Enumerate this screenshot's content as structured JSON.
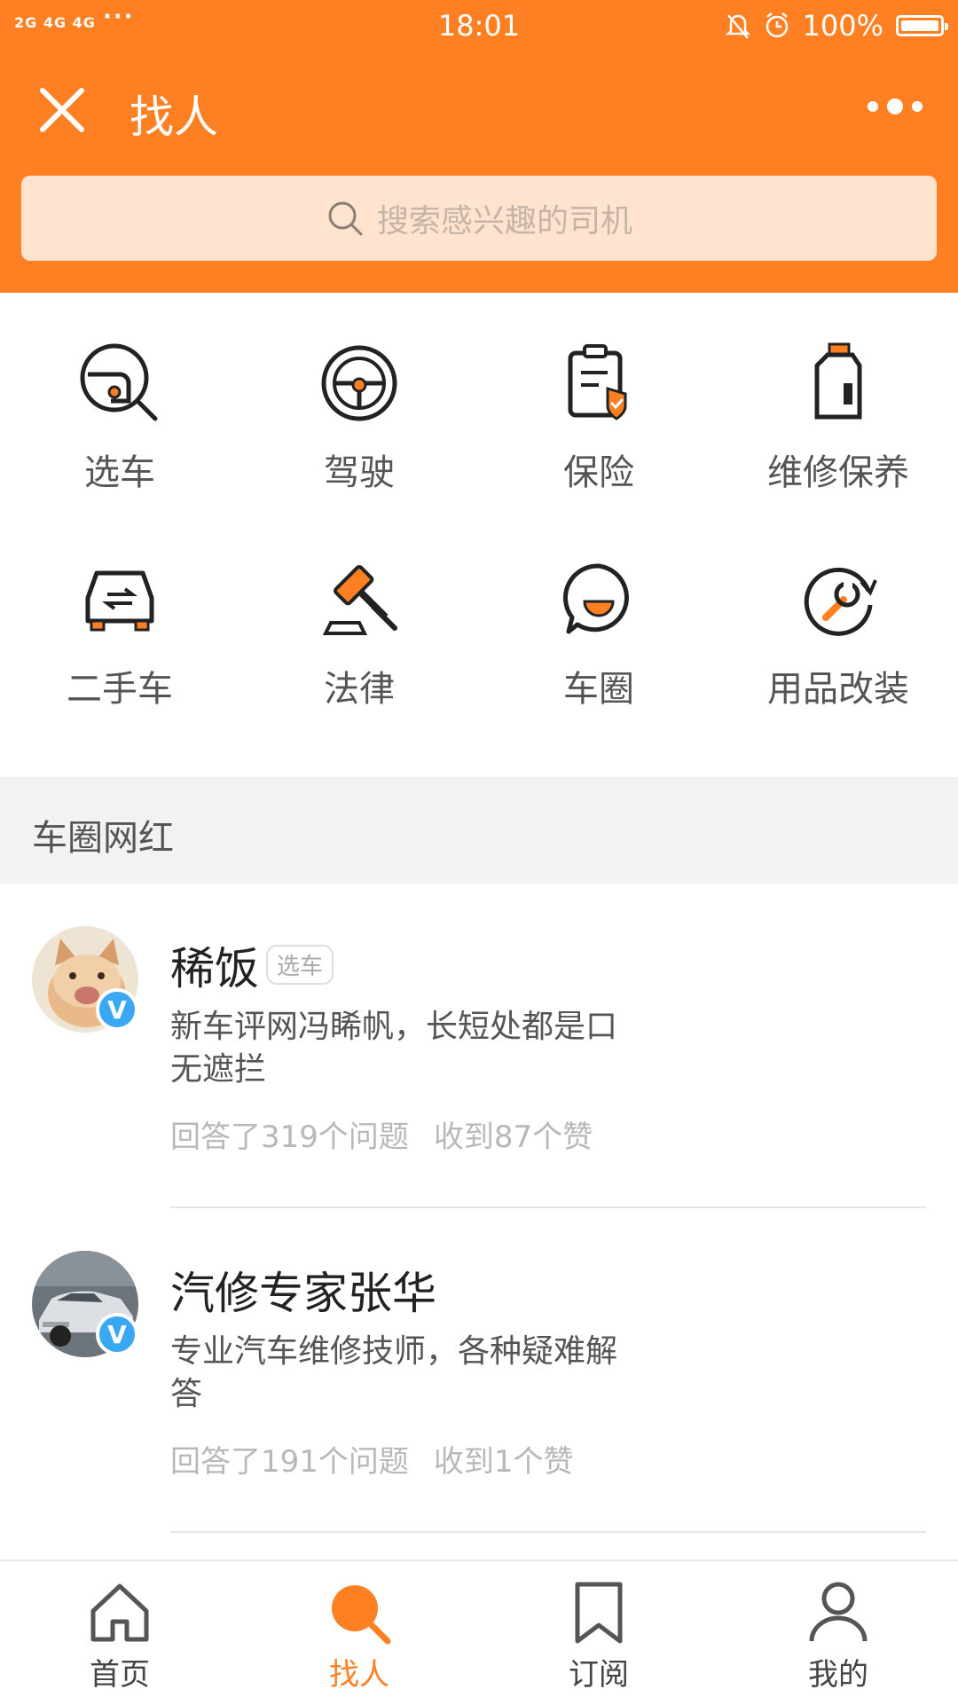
{
  "status_bar": {
    "network": "2G 4G 4G",
    "time": "18:01",
    "battery": "100%"
  },
  "header": {
    "title": "找人"
  },
  "search": {
    "placeholder": "搜索感兴趣的司机"
  },
  "categories": [
    {
      "label": "选车",
      "icon": "car-search-icon"
    },
    {
      "label": "驾驶",
      "icon": "steering-wheel-icon"
    },
    {
      "label": "保险",
      "icon": "insurance-clipboard-icon"
    },
    {
      "label": "维修保养",
      "icon": "oil-can-icon"
    },
    {
      "label": "二手车",
      "icon": "used-car-icon"
    },
    {
      "label": "法律",
      "icon": "gavel-icon"
    },
    {
      "label": "车圈",
      "icon": "chat-bubble-icon"
    },
    {
      "label": "用品改装",
      "icon": "wrench-refresh-icon"
    }
  ],
  "section": {
    "title": "车圈网红"
  },
  "feed": [
    {
      "name": "稀饭",
      "tag": "选车",
      "desc_line1": "新车评网冯睎帆，长短处都是口",
      "desc_line2": "无遮拦",
      "answers": "回答了319个问题",
      "likes": "收到87个赞",
      "verified": "V"
    },
    {
      "name": "汽修专家张华",
      "tag": "",
      "desc_line1": "专业汽车维修技师，各种疑难解",
      "desc_line2": "答",
      "answers": "回答了191个问题",
      "likes": "收到1个赞",
      "verified": "V"
    }
  ],
  "bottom_nav": [
    {
      "label": "首页",
      "icon": "home-icon"
    },
    {
      "label": "找人",
      "icon": "search-icon",
      "active": true
    },
    {
      "label": "订阅",
      "icon": "bookmark-icon"
    },
    {
      "label": "我的",
      "icon": "user-icon"
    }
  ],
  "colors": {
    "accent": "#FE8023",
    "search_bg": "#FFE3CF",
    "verified": "#3AA7F3"
  }
}
